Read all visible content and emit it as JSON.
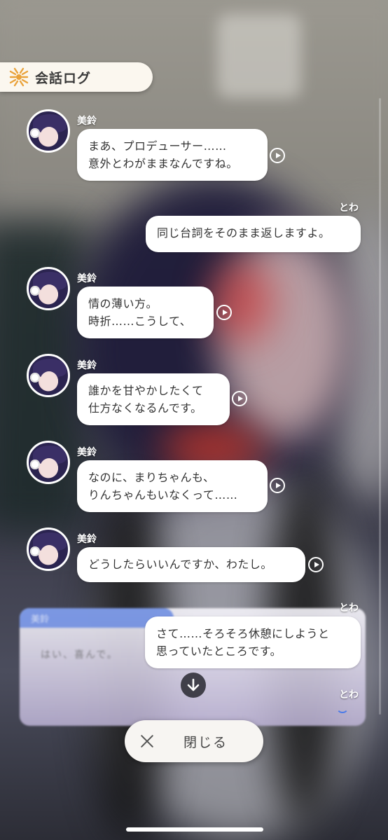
{
  "header": {
    "title": "会話ログ",
    "icon": "chat-log-icon"
  },
  "messages": [
    {
      "speaker": "美鈴",
      "side": "left",
      "lines": [
        "まあ、プロデューサー……",
        "意外とわがままなんですね。"
      ],
      "has_voice": true
    },
    {
      "speaker": "とわ",
      "side": "right",
      "lines": [
        "同じ台詞をそのまま返しますよ。"
      ],
      "has_voice": false
    },
    {
      "speaker": "美鈴",
      "side": "left",
      "lines": [
        "情の薄い方。",
        "時折……こうして、"
      ],
      "has_voice": true
    },
    {
      "speaker": "美鈴",
      "side": "left",
      "lines": [
        "誰かを甘やかしたくて",
        "仕方なくなるんです。"
      ],
      "has_voice": true
    },
    {
      "speaker": "美鈴",
      "side": "left",
      "lines": [
        "なのに、まりちゃんも、",
        "りんちゃんもいなくって……"
      ],
      "has_voice": true
    },
    {
      "speaker": "美鈴",
      "side": "left",
      "lines": [
        "どうしたらいいんですか、わたし。"
      ],
      "has_voice": true
    },
    {
      "speaker": "とわ",
      "side": "right",
      "lines": [
        "さて……そろそろ休憩にしようと",
        "思っていたところです。"
      ],
      "has_voice": false
    },
    {
      "speaker": "とわ",
      "side": "right",
      "lines": [],
      "has_voice": false
    }
  ],
  "background_textbox": {
    "name": "美鈴",
    "line": "はい、喜んで。"
  },
  "controls": {
    "close_label": "閉じる",
    "scroll_down_icon": "arrow-down-icon"
  },
  "colors": {
    "bubble": "#ffffff",
    "header_bg": "#fbf7ef",
    "accent_blue": "#4c7be8",
    "logo_orange": "#e9a23b"
  }
}
